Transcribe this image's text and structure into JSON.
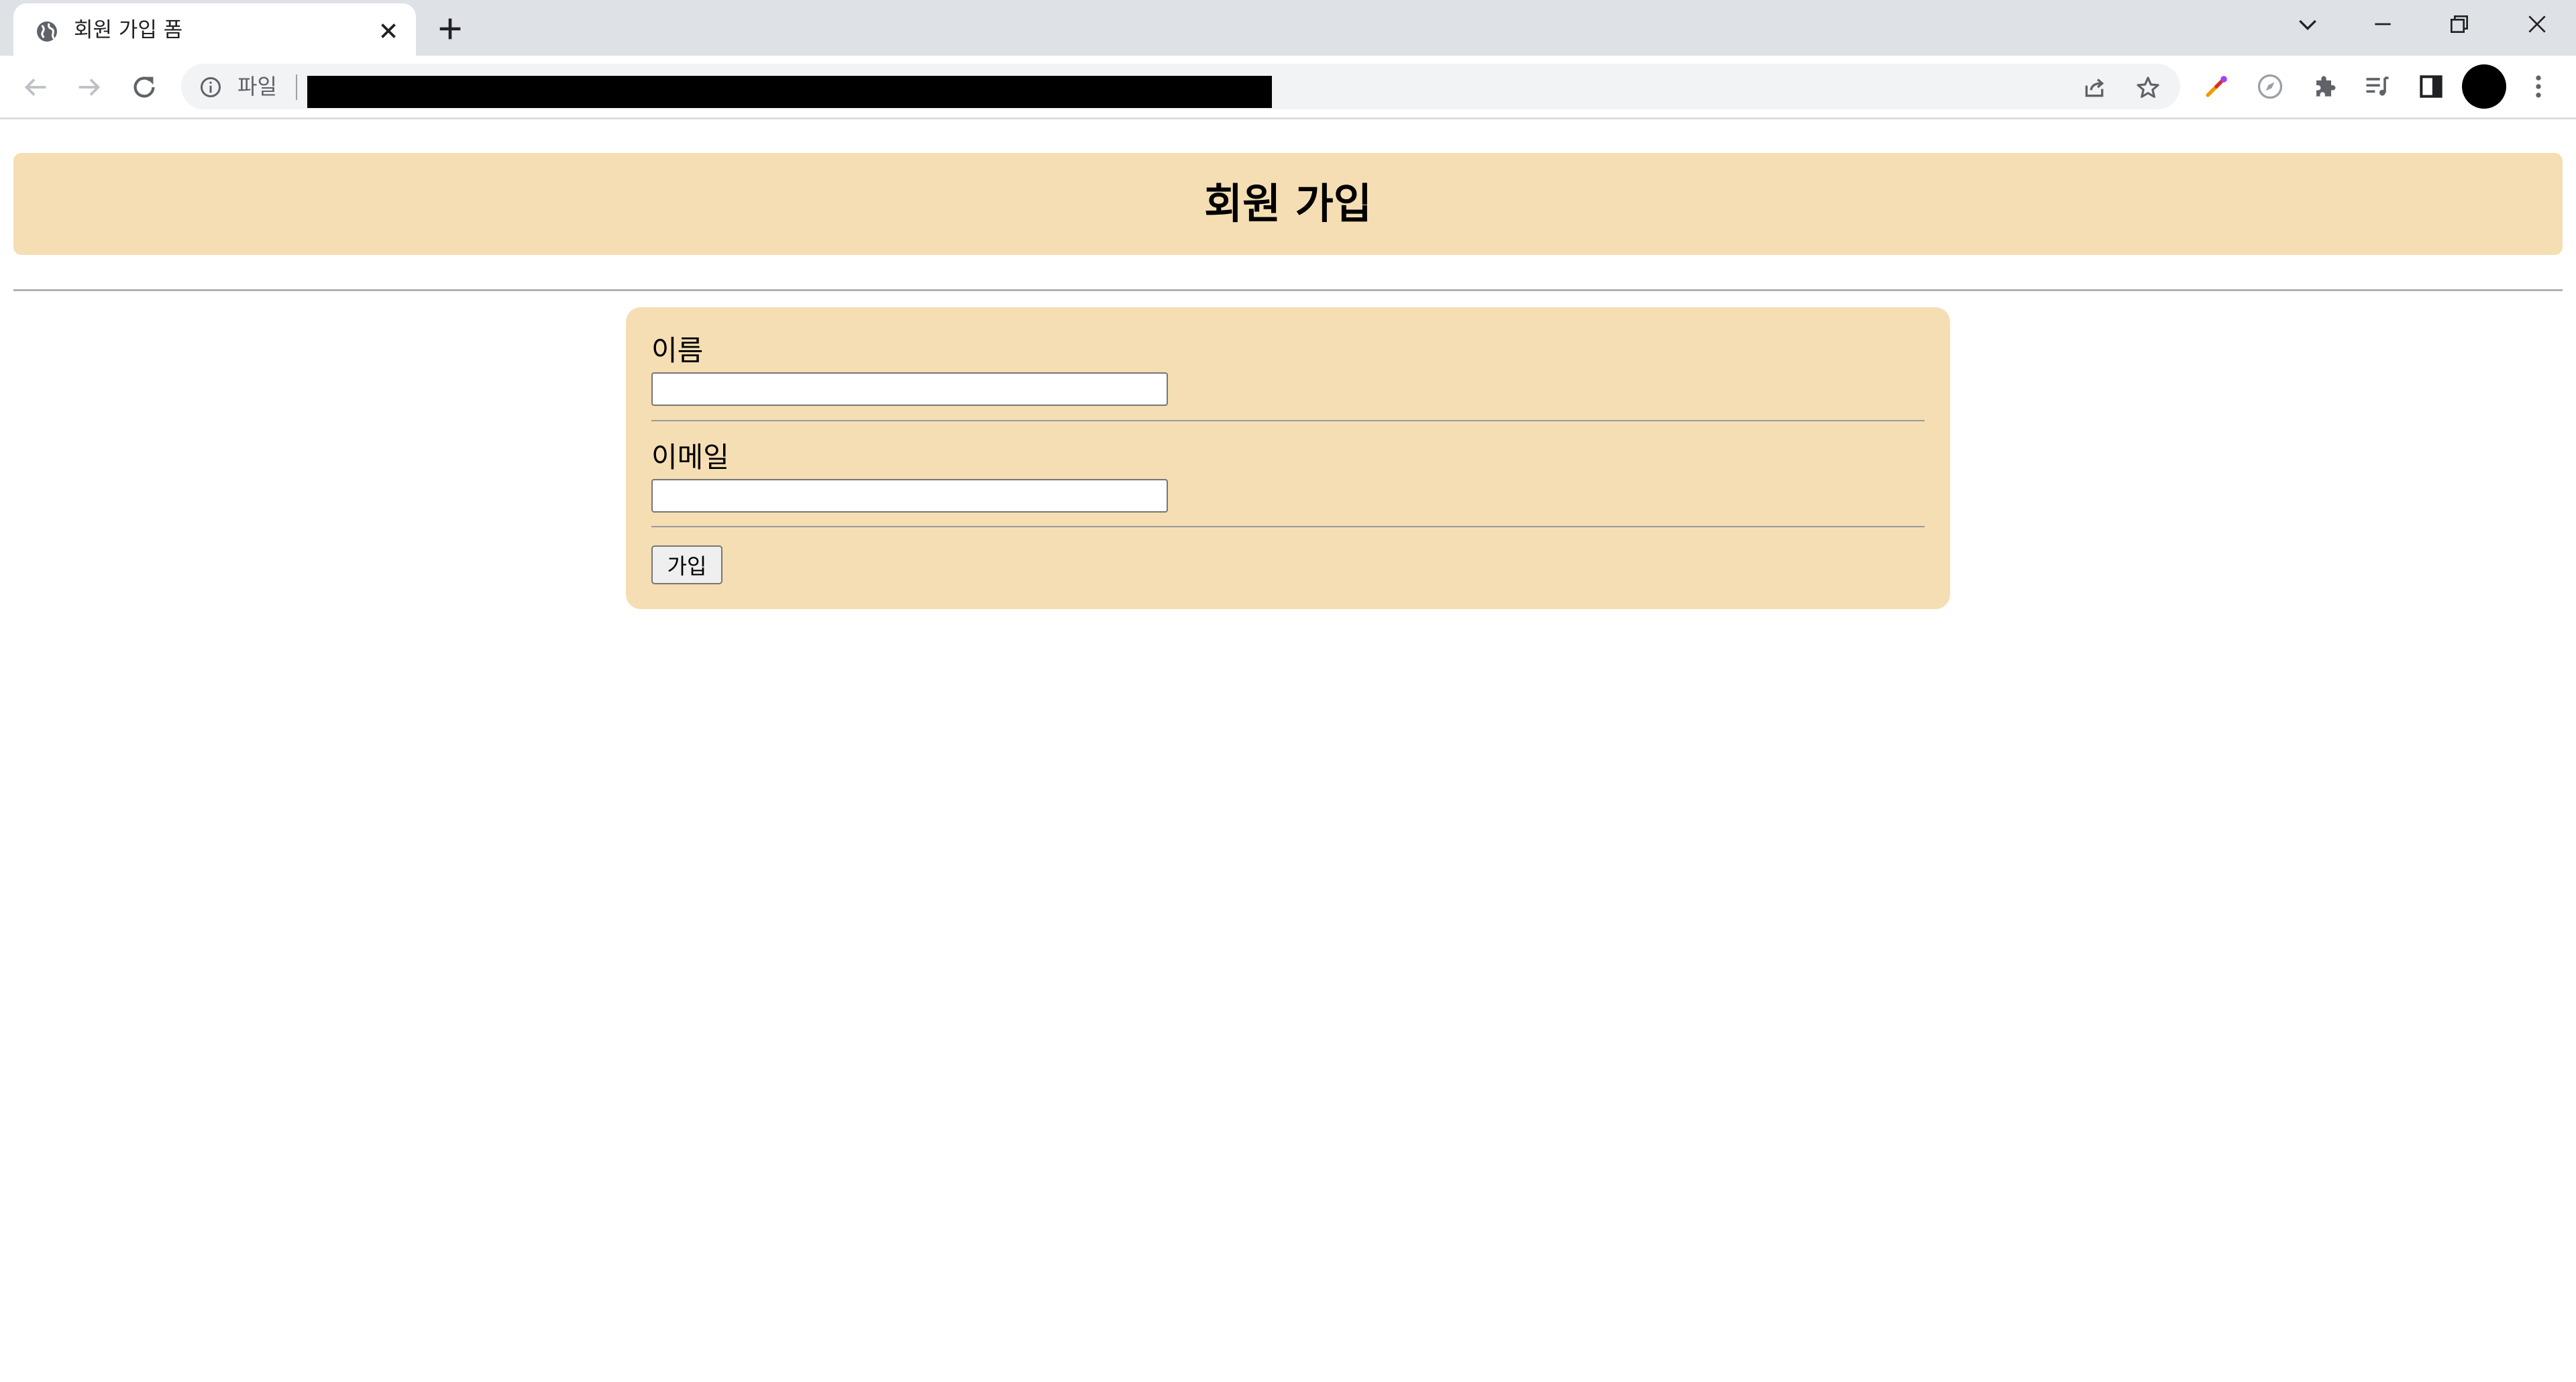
{
  "browser": {
    "tab": {
      "title": "회원 가입 폼",
      "favicon": "globe-icon",
      "close_icon": "close-icon"
    },
    "new_tab_icon": "plus-icon",
    "window_controls": [
      "chevron-down-icon",
      "minimize-icon",
      "restore-icon",
      "close-icon"
    ],
    "address_bar": {
      "scheme_label": "파일",
      "info_icon": "info-icon",
      "url_redacted": true,
      "share_icon": "share-icon",
      "bookmark_icon": "star-icon"
    },
    "toolbar_icons": [
      "color-picker-icon",
      "compass-icon",
      "extensions-icon",
      "reading-list-icon",
      "side-panel-icon",
      "profile-avatar",
      "more-menu-icon"
    ]
  },
  "page": {
    "title": "회원 가입",
    "colors": {
      "banner": "#f5deb3",
      "form": "#f5deb3"
    },
    "form": {
      "name_label": "이름",
      "name_value": "",
      "email_label": "이메일",
      "email_value": "",
      "submit_label": "가입"
    }
  }
}
